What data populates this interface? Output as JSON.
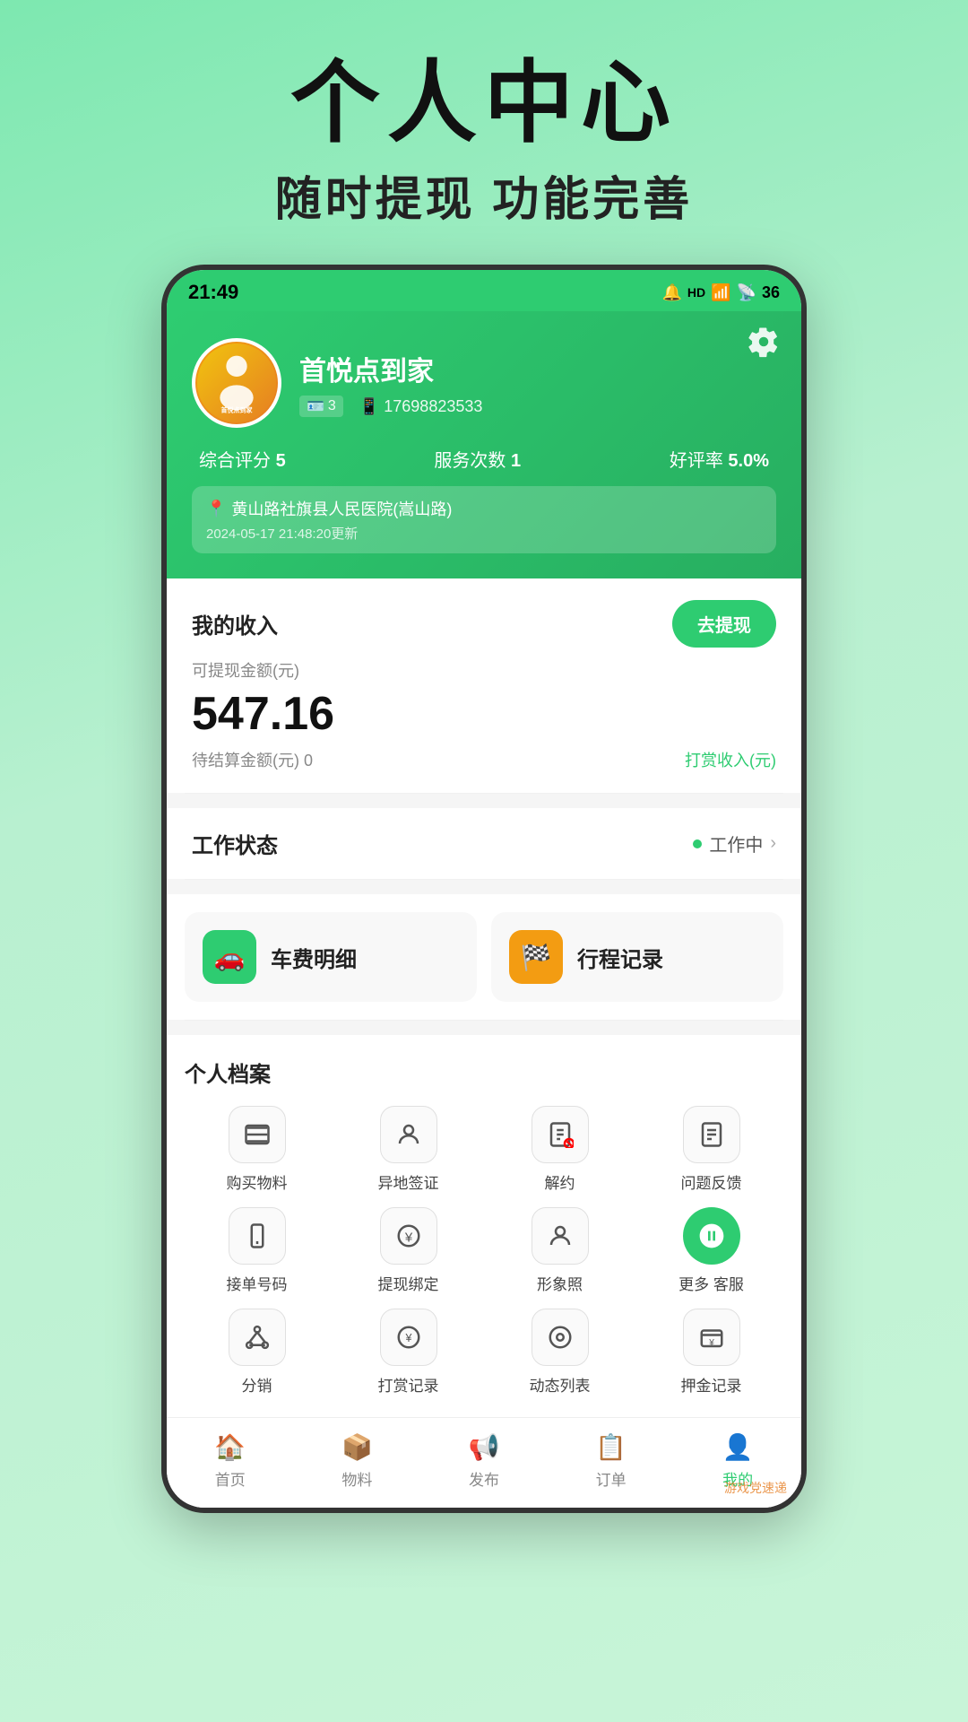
{
  "page": {
    "title_main": "个人中心",
    "title_sub": "随时提现 功能完善"
  },
  "statusBar": {
    "time": "21:49",
    "battery": "36"
  },
  "profile": {
    "name": "首悦点到家",
    "id_badge": "3",
    "phone": "17698823533",
    "rating_label": "综合评分",
    "rating_value": "5",
    "service_label": "服务次数",
    "service_value": "1",
    "good_rate_label": "好评率",
    "good_rate_value": "5.0%",
    "location": "黄山路社旗县人民医院(嵩山路)",
    "location_update": "2024-05-17 21:48:20更新",
    "settings_label": "设置"
  },
  "income": {
    "title": "我的收入",
    "withdraw_btn": "去提现",
    "available_label": "可提现金额(元)",
    "amount": "547.16",
    "pending_label": "待结算金额(元) 0",
    "tip_label": "打赏收入(元)"
  },
  "workStatus": {
    "label": "工作状态",
    "value": "工作中",
    "chevron": ">"
  },
  "quickActions": [
    {
      "label": "车费明细",
      "icon": "🚗",
      "color": "green"
    },
    {
      "label": "行程记录",
      "icon": "🏁",
      "color": "orange"
    }
  ],
  "archive": {
    "title": "个人档案",
    "items": [
      {
        "icon": "📁",
        "label": "购买物料"
      },
      {
        "icon": "👤",
        "label": "异地签证"
      },
      {
        "icon": "📋",
        "label": "解约"
      },
      {
        "icon": "📄",
        "label": "问题反馈"
      },
      {
        "icon": "📱",
        "label": "接单号码"
      },
      {
        "icon": "💴",
        "label": "提现绑定"
      },
      {
        "icon": "📷",
        "label": "形象照"
      },
      {
        "icon": "💬",
        "label": "更多 客服"
      },
      {
        "icon": "🌐",
        "label": "分销"
      },
      {
        "icon": "💝",
        "label": "打赏记录"
      },
      {
        "icon": "🎯",
        "label": "动态列表"
      },
      {
        "icon": "💰",
        "label": "押金记录"
      }
    ]
  },
  "bottomNav": [
    {
      "icon": "🏠",
      "label": "首页",
      "active": false
    },
    {
      "icon": "📦",
      "label": "物料",
      "active": false
    },
    {
      "icon": "📢",
      "label": "发布",
      "active": false
    },
    {
      "icon": "📋",
      "label": "订单",
      "active": false
    },
    {
      "icon": "👤",
      "label": "我的",
      "active": true
    }
  ],
  "watermark": "游戏党速递"
}
